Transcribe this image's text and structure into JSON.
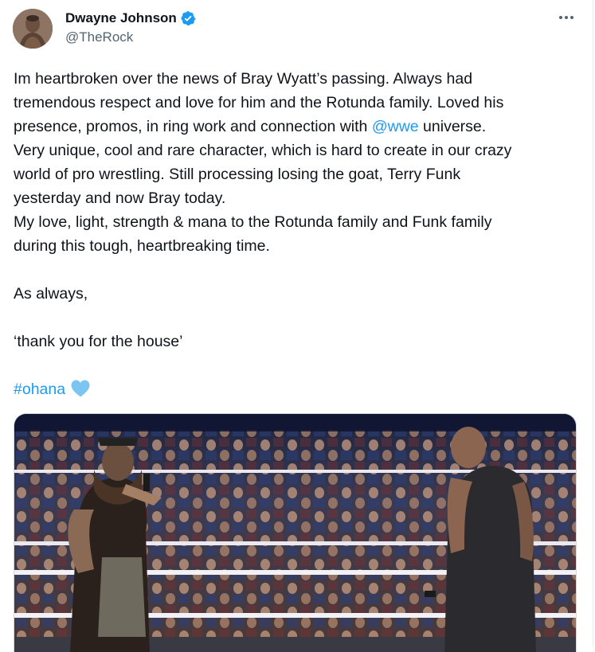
{
  "author": {
    "display_name": "Dwayne Johnson",
    "handle": "@TheRock",
    "avatar_icon": "profile-photo",
    "verified_icon": "verified-badge-icon",
    "verified_color": "#1d9bf0"
  },
  "menu": {
    "icon": "more-options-icon"
  },
  "tweet": {
    "line1": "Im heartbroken over the news of Bray Wyatt’s passing. Always had",
    "line2": "tremendous respect and love for him and the Rotunda family. Loved his",
    "line3_before": "presence, promos, in ring work and connection with ",
    "line3_mention": "@wwe",
    "line3_after": " universe.",
    "line4": "Very unique, cool and rare character, which is hard to create in our crazy",
    "line5": "world of pro wrestling. Still processing losing the goat, Terry Funk",
    "line6": "yesterday and now Bray today.",
    "line7": "My love, light, strength & mana to the Rotunda family and Funk family",
    "line8": "during this tough, heartbreaking time.",
    "line9": "As always,",
    "line10": "‘thank you for the house’",
    "hashtag": "#ohana",
    "heart_icon": "light-blue-heart-emoji",
    "link_color": "#1d9bf0",
    "heart_color": "#7cc4f2"
  },
  "media": {
    "type": "photo",
    "description_icon": "wrestling-ring-photo"
  }
}
